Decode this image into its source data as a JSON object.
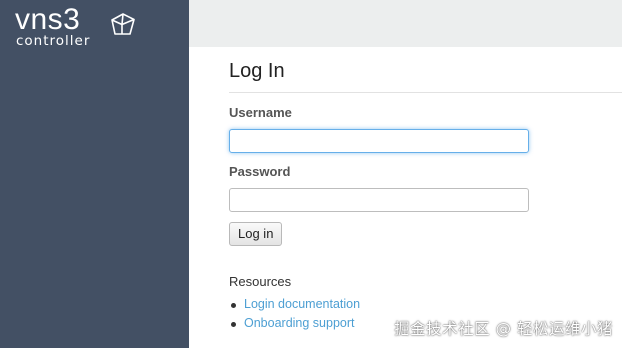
{
  "brand": {
    "name": "vns3",
    "subtitle": "controller",
    "logo_icon": "cube-icon"
  },
  "page": {
    "title": "Log In"
  },
  "form": {
    "username_label": "Username",
    "username_value": "",
    "password_label": "Password",
    "password_value": "",
    "submit_label": "Log in"
  },
  "resources": {
    "heading": "Resources",
    "links": [
      {
        "label": "Login documentation"
      },
      {
        "label": "Onboarding support"
      }
    ]
  },
  "watermark": "掘金技术社区 @ 轻松运维小猪",
  "colors": {
    "sidebar": "#435064",
    "topbar": "#eceeee",
    "link": "#4d9fd3",
    "focus": "#66afe9"
  }
}
